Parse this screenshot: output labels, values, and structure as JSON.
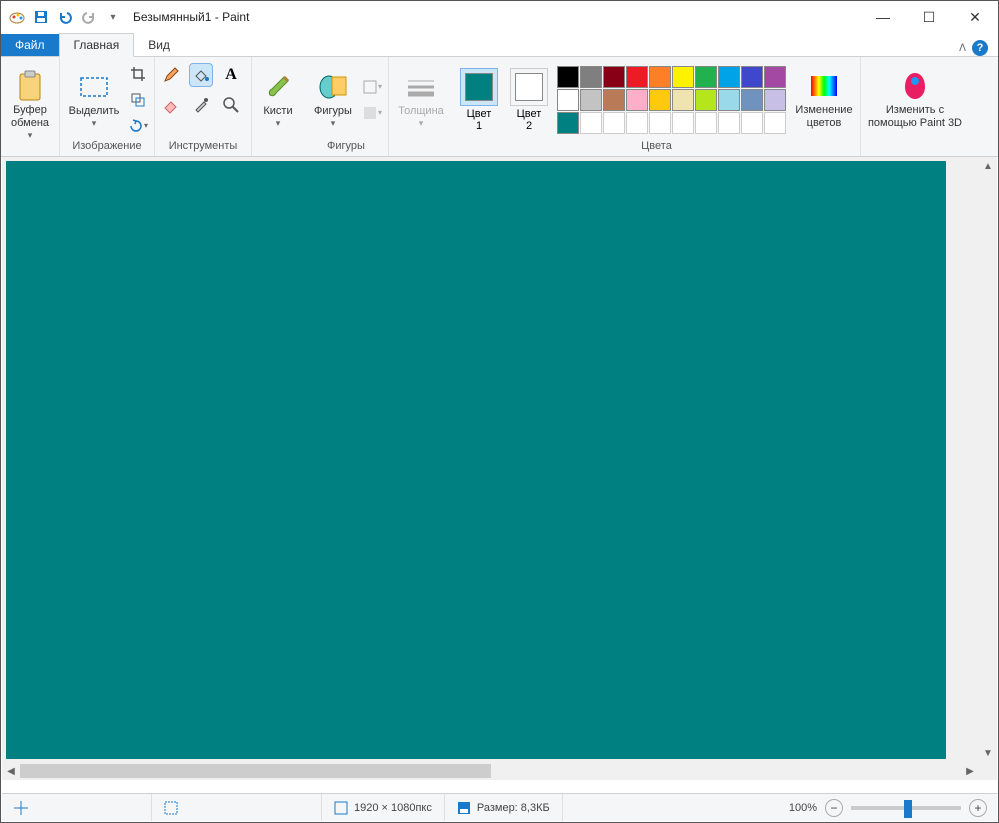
{
  "title": "Безымянный1 - Paint",
  "tabs": {
    "file": "Файл",
    "home": "Главная",
    "view": "Вид"
  },
  "ribbon": {
    "clipboard": {
      "paste": "Буфер\nобмена",
      "label": ""
    },
    "image": {
      "select": "Выделить",
      "label": "Изображение"
    },
    "tools": {
      "label": "Инструменты"
    },
    "brushes": {
      "btn": "Кисти"
    },
    "shapes": {
      "btn": "Фигуры",
      "label": "Фигуры"
    },
    "thickness": "Толщина",
    "color1_label": "Цвет\n1",
    "color2_label": "Цвет\n2",
    "edit_colors": "Изменение\nцветов",
    "colors_label": "Цвета",
    "paint3d": "Изменить с\nпомощью Paint 3D"
  },
  "colors": {
    "color1": "#008080",
    "color2": "#ffffff",
    "row1": [
      "#000000",
      "#7f7f7f",
      "#880015",
      "#ed1c24",
      "#ff7f27",
      "#fff200",
      "#22b14c",
      "#00a2e8",
      "#3f48cc",
      "#a349a4"
    ],
    "row2": [
      "#ffffff",
      "#c3c3c3",
      "#b97a57",
      "#ffaec9",
      "#ffc90e",
      "#efe4b0",
      "#b5e61d",
      "#99d9ea",
      "#7092be",
      "#c8bfe7"
    ],
    "row3": [
      "#008080",
      "",
      "",
      "",
      "",
      "",
      "",
      "",
      "",
      ""
    ]
  },
  "status": {
    "dims": "1920 × 1080пкс",
    "size_label": "Размер: 8,3КБ",
    "zoom": "100%"
  }
}
